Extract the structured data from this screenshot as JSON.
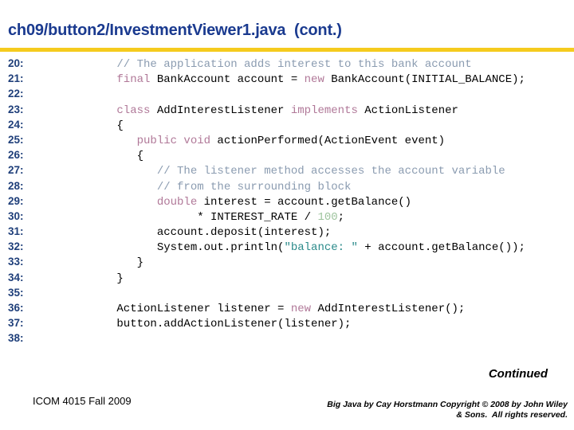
{
  "slide": {
    "title": "ch09/button2/InvestmentViewer1.java  (cont.)",
    "accent_rule_color": "#f5cb1e",
    "title_color": "#1a3a8f"
  },
  "syntax_colors": {
    "line_number": "#1f3f7a",
    "comment": "#8a9bb0",
    "keyword": "#b07898",
    "string": "#2a8a8a",
    "number": "#9ec49e",
    "plain": "#000000"
  },
  "code": {
    "lines": [
      {
        "num": "20:",
        "tokens": [
          {
            "t": "comment",
            "s": "      // The application adds interest to this bank account"
          }
        ]
      },
      {
        "num": "21:",
        "tokens": [
          {
            "t": "keyword",
            "s": "      final"
          },
          {
            "t": "plain",
            "s": " BankAccount account = "
          },
          {
            "t": "keyword",
            "s": "new"
          },
          {
            "t": "plain",
            "s": " BankAccount(INITIAL_BALANCE);"
          }
        ]
      },
      {
        "num": "22:",
        "tokens": [
          {
            "t": "plain",
            "s": ""
          }
        ]
      },
      {
        "num": "23:",
        "tokens": [
          {
            "t": "keyword",
            "s": "      class"
          },
          {
            "t": "plain",
            "s": " AddInterestListener "
          },
          {
            "t": "keyword",
            "s": "implements"
          },
          {
            "t": "plain",
            "s": " ActionListener"
          }
        ]
      },
      {
        "num": "24:",
        "tokens": [
          {
            "t": "plain",
            "s": "      {"
          }
        ]
      },
      {
        "num": "25:",
        "tokens": [
          {
            "t": "keyword",
            "s": "         public void"
          },
          {
            "t": "plain",
            "s": " actionPerformed(ActionEvent event)"
          }
        ]
      },
      {
        "num": "26:",
        "tokens": [
          {
            "t": "plain",
            "s": "         {"
          }
        ]
      },
      {
        "num": "27:",
        "tokens": [
          {
            "t": "comment",
            "s": "            // The listener method accesses the account variable"
          }
        ]
      },
      {
        "num": "28:",
        "tokens": [
          {
            "t": "comment",
            "s": "            // from the surrounding block"
          }
        ]
      },
      {
        "num": "29:",
        "tokens": [
          {
            "t": "keyword",
            "s": "            double"
          },
          {
            "t": "plain",
            "s": " interest = account.getBalance()"
          }
        ]
      },
      {
        "num": "30:",
        "tokens": [
          {
            "t": "plain",
            "s": "                  * INTEREST_RATE / "
          },
          {
            "t": "number",
            "s": "100"
          },
          {
            "t": "plain",
            "s": ";"
          }
        ]
      },
      {
        "num": "31:",
        "tokens": [
          {
            "t": "plain",
            "s": "            account.deposit(interest);"
          }
        ]
      },
      {
        "num": "32:",
        "tokens": [
          {
            "t": "plain",
            "s": "            System.out.println("
          },
          {
            "t": "string",
            "s": "\"balance: \""
          },
          {
            "t": "plain",
            "s": " + account.getBalance());"
          }
        ]
      },
      {
        "num": "33:",
        "tokens": [
          {
            "t": "plain",
            "s": "         }"
          }
        ]
      },
      {
        "num": "34:",
        "tokens": [
          {
            "t": "plain",
            "s": "      }"
          }
        ]
      },
      {
        "num": "35:",
        "tokens": [
          {
            "t": "plain",
            "s": ""
          }
        ]
      },
      {
        "num": "36:",
        "tokens": [
          {
            "t": "plain",
            "s": "      ActionListener listener = "
          },
          {
            "t": "keyword",
            "s": "new"
          },
          {
            "t": "plain",
            "s": " AddInterestListener();"
          }
        ]
      },
      {
        "num": "37:",
        "tokens": [
          {
            "t": "plain",
            "s": "      button.addActionListener(listener);"
          }
        ]
      },
      {
        "num": "38:",
        "tokens": [
          {
            "t": "plain",
            "s": ""
          }
        ]
      }
    ]
  },
  "footer": {
    "continued": "Continued",
    "course": "ICOM 4015 Fall 2009",
    "attribution_line1": "Big Java by Cay Horstmann Copyright © 2008 by John Wiley",
    "attribution_line2": "& Sons.  All rights reserved."
  }
}
